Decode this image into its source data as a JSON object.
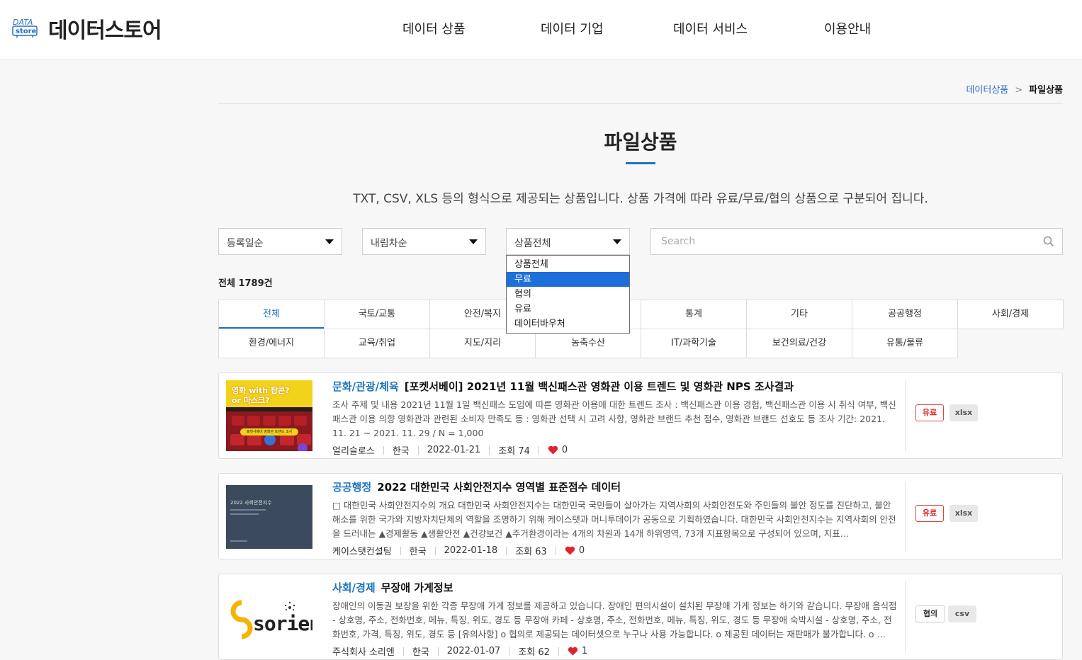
{
  "header": {
    "logo_top": "DATA",
    "logo_bottom": "store",
    "site_name": "데이터스토어",
    "nav": [
      "데이터 상품",
      "데이터 기업",
      "데이터 서비스",
      "이용안내"
    ]
  },
  "breadcrumb": {
    "parent": "데이터상품",
    "separator": ">",
    "current": "파일상품"
  },
  "page": {
    "title": "파일상품",
    "description": "TXT, CSV, XLS 등의 형식으로 제공되는 상품입니다. 상품 가격에 따라 유료/무료/협의 상품으로 구분되어 집니다."
  },
  "filters": {
    "sort_by": "등록일순",
    "order": "내림차순",
    "price_type": "상품전체",
    "search_placeholder": "Search",
    "price_options": [
      "상품전체",
      "무료",
      "협의",
      "유료",
      "데이터바우처"
    ],
    "highlighted_option": "무료"
  },
  "total": "전체 1789건",
  "categories": {
    "row1": [
      "전체",
      "국토/교통",
      "안전/복지",
      "",
      "통계",
      "기타",
      "공공행정",
      "사회/경제"
    ],
    "row2": [
      "환경/에너지",
      "교육/취업",
      "지도/지리",
      "농축수산",
      "IT/과학기술",
      "보건의료/건강",
      "유통/물류"
    ],
    "active": "전체"
  },
  "products": [
    {
      "category": "문화/관광/체육",
      "title": "[포켓서베이] 2021년 11월 백신패스관 영화관 이용 트렌드 및 영화관 NPS 조사결과",
      "description": "조사 주제 및 내용 2021년 11월 1일 백신패스 도입에 따른 영화관 이용에 대한 트렌드 조사 : 백신패스관 이용 경험, 백신패스관 이용 시 취식 여부, 백신패스관 이용 의향 영화관과 관련된 소비자 만족도 등 : 영화관 선택 시 고려 사항, 영화관 브랜드 추천 점수, 영화관 브랜드 선호도 등 조사 기간: 2021. 11. 21 ~ 2021. 11. 29 / N = 1,000",
      "provider": "얼리슬로스",
      "country": "한국",
      "date": "2022-01-21",
      "views": "조회 74",
      "likes": "0",
      "price_badge": "유료",
      "format": "xlsx",
      "thumb_text_1": "영화 with 팝콘?",
      "thumb_text_2": "or 마스크?",
      "thumb_caption": "포켓서베이 영화관 트렌드 조사"
    },
    {
      "category": "공공행정",
      "title": "2022 대한민국 사회안전지수 영역별 표준점수 데이터",
      "description": "□ 대한민국 사회안전지수의 개요 대한민국 사회안전지수는 대한민국 국민들이 살아가는 지역사회의 사회안전도와 주민들의 불안 정도를 진단하고, 불안 해소를 위한 국가와 지방자치단체의 역할을 조명하기 위해 케이스탯과 머니투데이가 공동으로 기획하였습니다. 대한민국 사회안전지수는 지역사회의 안전을 드러내는 ▲경제활동 ▲생활안전 ▲건강보건 ▲주거환경이라는 4개의 차원과 14개 하위영역, 73개 지표항목으로 구성되어 있으며, 지표…",
      "provider": "케이스탯컨설팅",
      "country": "한국",
      "date": "2022-01-18",
      "views": "조회 63",
      "likes": "0",
      "price_badge": "유료",
      "format": "xlsx",
      "thumb_text_1": "2022 사회안전지수",
      "thumb_text_2": "",
      "thumb_caption": ""
    },
    {
      "category": "사회/경제",
      "title": "무장애 가게정보",
      "description": "장애인의 이동권 보장을 위한 각종 무장애 가게 정보를 제공하고 있습니다. 장애인 편의시설이 설치된 무장애 가게 정보는 하기와 같습니다. 무장애 음식점 - 상호명, 주소, 전화번호, 메뉴, 특징, 위도, 경도 등 무장애 카페 - 상호명, 주소, 전화번호, 메뉴, 특징, 위도, 경도 등 무장애 숙박시설 - 상호명, 주소, 전화번호, 가격, 특징, 위도, 경도 등 [유의사항] o 협의로 제공되는 데이터셋으로 누구나 사용 가능합니다. o 제공된 데이터는 재판매가 불가합니다. o …",
      "provider": "주식회사 소리엔",
      "country": "한국",
      "date": "2022-01-07",
      "views": "조회 62",
      "likes": "1",
      "price_badge": "협의",
      "format": "csv",
      "thumb_text_1": "sorien",
      "thumb_text_2": "",
      "thumb_caption": ""
    }
  ],
  "colors": {
    "accent": "#1e73be",
    "paid_badge": "#dd2222",
    "heart": "#e0242e",
    "dropdown_highlight": "#1e6fd9"
  }
}
